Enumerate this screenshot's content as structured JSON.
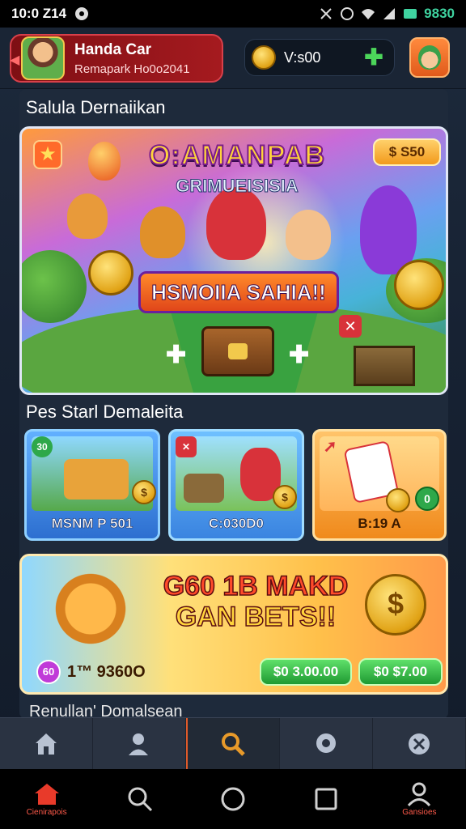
{
  "status_bar": {
    "time": "10:0 Z14",
    "battery": "9830"
  },
  "header": {
    "profile_name": "Handa Car",
    "profile_sub": "Remapark Ho0o2041",
    "coins": "V:s00"
  },
  "featured": {
    "section_title": "Salula Dernaiikan",
    "title": "O:AMANPAB",
    "subtitle": "GRIMUEISISIA",
    "price": "$ S50",
    "banner": "HSMOIIA SAHIA!!"
  },
  "cards_section": {
    "title": "Pes Starl Demaleita",
    "cards": [
      {
        "label": "MSNM P 501",
        "badge": "30"
      },
      {
        "label": "C:030D0",
        "badge": "✕"
      },
      {
        "label": "B:19 A",
        "badge": ""
      }
    ],
    "card_coin_1": "$",
    "card_coin_2": "$",
    "card_coin_3": "0"
  },
  "promo": {
    "title_line1": "G60 1B MAKD",
    "title_line2": "GAN BETS!!",
    "stat_badge": "60",
    "stat_value": "1™ 9360O",
    "button_1": "$0 3.00.00",
    "button_2": "$0 $7.00",
    "coin_symbol": "$"
  },
  "section3": {
    "title": "Renullan' Domalsean"
  },
  "bottom_nav": {
    "items": [
      "home",
      "profile",
      "search",
      "chat",
      "close"
    ]
  },
  "system_nav": {
    "home_label": "Cienirapois",
    "profile_label": "Gansioes"
  }
}
